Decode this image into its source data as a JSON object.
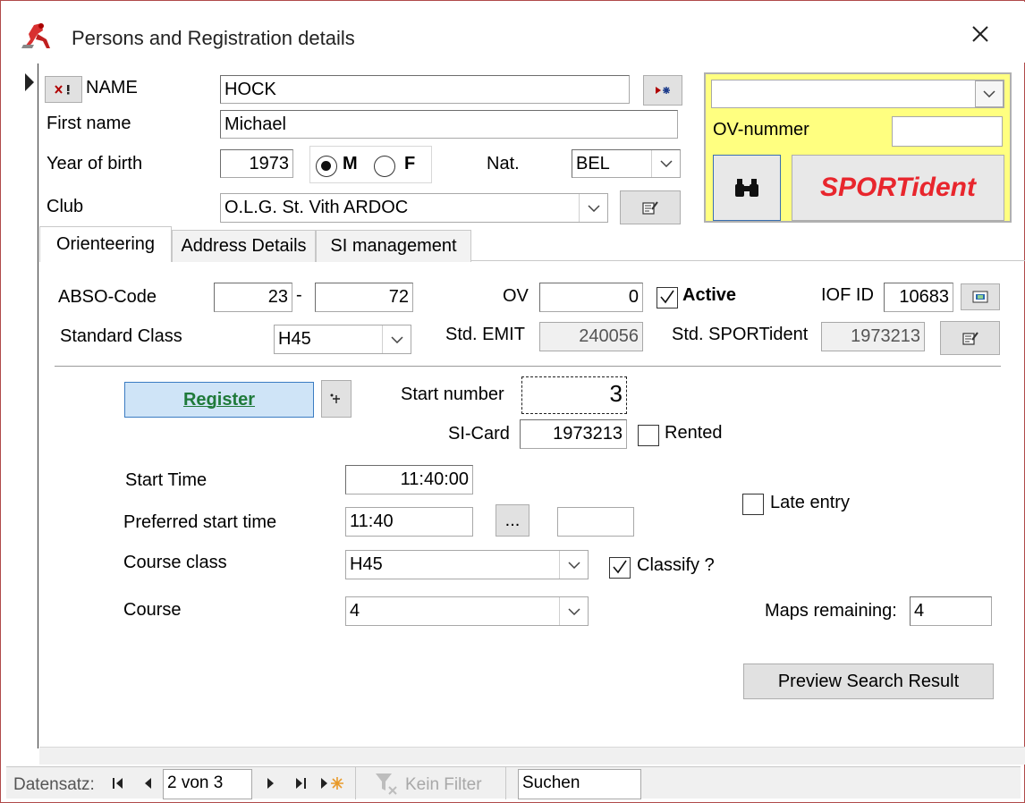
{
  "window": {
    "title": "Persons and Registration details"
  },
  "person": {
    "name_label": "NAME",
    "name_value": "HOCK",
    "first_name_label": "First name",
    "first_name_value": "Michael",
    "year_label": "Year of birth",
    "year_value": "1973",
    "sex_m": "M",
    "sex_f": "F",
    "nat_label": "Nat.",
    "nat_value": "BEL",
    "club_label": "Club",
    "club_value": "O.L.G. St. Vith ARDOC"
  },
  "si_panel": {
    "ov_nummer_label": "OV-nummer",
    "sportident_label": "SPORTident",
    "brand_color": "#e8262d",
    "panel_color": "#ffff80"
  },
  "tabs": [
    {
      "label": "Orienteering"
    },
    {
      "label": "Address Details"
    },
    {
      "label": "SI management"
    }
  ],
  "orienteering": {
    "abso_label": "ABSO-Code",
    "abso_1": "23",
    "abso_sep": "-",
    "abso_2": "72",
    "ov_label": "OV",
    "ov_value": "0",
    "active_label": "Active",
    "iof_label": "IOF ID",
    "iof_value": "10683",
    "std_class_label": "Standard Class",
    "std_class_value": "H45",
    "std_emit_label": "Std. EMIT",
    "std_emit_value": "240056",
    "std_si_label": "Std. SPORTident",
    "std_si_value": "1973213"
  },
  "registration": {
    "register_label": "Register",
    "start_number_label": "Start number",
    "start_number_value": "3",
    "si_card_label": "SI-Card",
    "si_card_value": "1973213",
    "rented_label": "Rented",
    "start_time_label": "Start Time",
    "start_time_value": "11:40:00",
    "pref_start_label": "Preferred start time",
    "pref_start_value": "11:40",
    "ellipsis_label": "...",
    "late_entry_label": "Late entry",
    "course_class_label": "Course class",
    "course_class_value": "H45",
    "classify_label": "Classify ?",
    "course_label": "Course",
    "course_value": "4",
    "maps_label": "Maps remaining:",
    "maps_value": "4",
    "preview_label": "Preview Search Result"
  },
  "statusbar": {
    "record_label": "Datensatz:",
    "record_value": "2 von 3",
    "filter_label": "Kein Filter",
    "search_value": "Suchen"
  }
}
